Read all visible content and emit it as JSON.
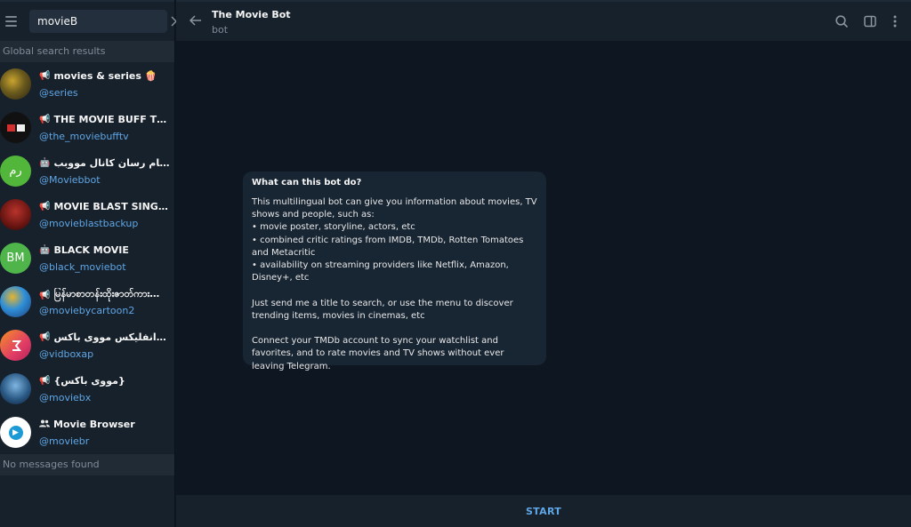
{
  "search": {
    "value": "movieB",
    "clear_icon": "close-icon"
  },
  "sidebar": {
    "section_header": "Global search results",
    "results": [
      {
        "title": "movies & series 🍿",
        "handle": "@series",
        "type_icon": "channel-icon",
        "avatar_text": ""
      },
      {
        "title": "THE MOVIE BUFF TV 🎥...",
        "handle": "@the_moviebufftv",
        "type_icon": "channel-icon",
        "avatar_text": ""
      },
      {
        "title": "ربات پیام رسان کانال مووبب",
        "handle": "@Moviebbot",
        "type_icon": "bot-icon",
        "avatar_text": "رم"
      },
      {
        "title": "MOVIE BLAST SINGLE FIL...",
        "handle": "@movieblastbackup",
        "type_icon": "channel-icon",
        "avatar_text": ""
      },
      {
        "title": "BLACK MOVIE",
        "handle": "@black_moviebot",
        "type_icon": "bot-icon",
        "avatar_text": "BM"
      },
      {
        "title": "မြန်မာစာတန်းထိုးဇာတ်ကားများ...",
        "handle": "@moviebycartoon2",
        "type_icon": "channel-icon",
        "avatar_text": ""
      },
      {
        "title": "ایرانفلیکس مووی باکس iran...",
        "handle": "@vidboxap",
        "type_icon": "channel-icon",
        "avatar_text": ""
      },
      {
        "title": "{مووی باکس}",
        "handle": "@moviebx",
        "type_icon": "channel-icon",
        "avatar_text": ""
      },
      {
        "title": "Movie Browser",
        "handle": "@moviebr",
        "type_icon": "group-icon",
        "avatar_text": ""
      }
    ],
    "no_messages": "No messages found"
  },
  "chat": {
    "bot_name": "The Movie Bot",
    "status": "bot",
    "info_title": "What can this bot do?",
    "info_text": "This multilingual bot can give you information about movies, TV shows and people, such as:\n• movie poster, storyline, actors, etc\n• combined critic ratings from IMDB, TMDb, Rotten Tomatoes and Metacritic\n• availability on streaming providers like Netflix, Amazon, Disney+, etc\n\nJust send me a title to search, or use the menu to discover trending items, movies in cinemas, etc\n\nConnect your TMDb account to sync your watchlist and favorites, and to rate movies and TV shows without ever leaving Telegram.",
    "start_label": "START"
  },
  "colors": {
    "sidebar_bg": "#17212b",
    "chat_bg": "#0e1621",
    "accent": "#5fa6e6",
    "bubble_bg": "#182533"
  }
}
